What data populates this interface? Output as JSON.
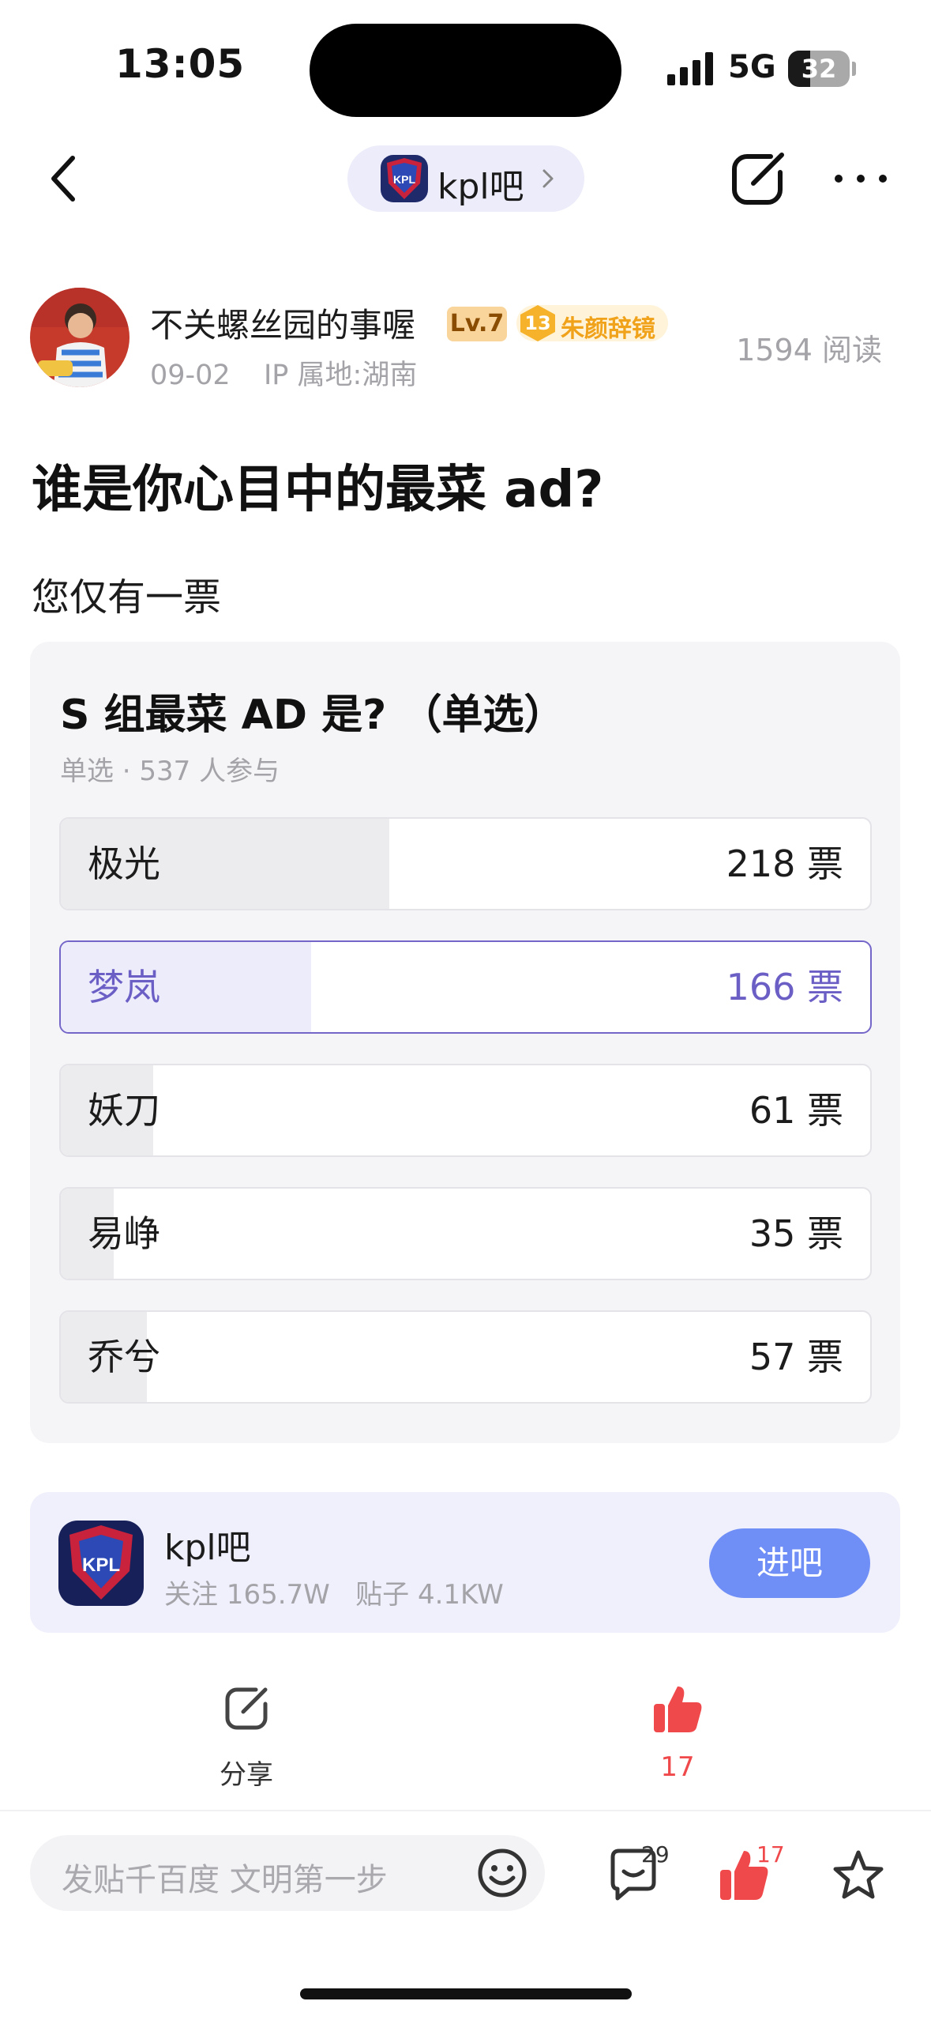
{
  "status_bar": {
    "time": "13:05",
    "network": "5G",
    "battery": "32"
  },
  "nav": {
    "forum_label": "kpl吧"
  },
  "author": {
    "name": "不关螺丝园的事喔",
    "level": "Lv.7",
    "fan_level": "13",
    "fan_label": "朱颜辞镜",
    "date": "09-02",
    "ip_location": "IP 属地:湖南",
    "reads": "1594 阅读"
  },
  "post": {
    "title": "谁是你心目中的最菜 ad?",
    "text": "您仅有一票"
  },
  "poll": {
    "title": "S 组最菜 AD 是? （单选）",
    "meta": "单选 · 537 人参与",
    "options": [
      {
        "name": "极光",
        "votes": "218 票",
        "share": 0.406,
        "selected": false
      },
      {
        "name": "梦岚",
        "votes": "166 票",
        "share": 0.309,
        "selected": true
      },
      {
        "name": "妖刀",
        "votes": "61 票",
        "share": 0.114,
        "selected": false
      },
      {
        "name": "易峥",
        "votes": "35 票",
        "share": 0.065,
        "selected": false
      },
      {
        "name": "乔兮",
        "votes": "57 票",
        "share": 0.106,
        "selected": false
      }
    ]
  },
  "forum_card": {
    "name": "kpl吧",
    "stats": "关注 165.7W   贴子 4.1KW",
    "enter_label": "进吧"
  },
  "actions": {
    "share_label": "分享",
    "like_count": "17"
  },
  "bottom_bar": {
    "placeholder": "发贴千百度 文明第一步",
    "comment_count": "29",
    "like_count": "17"
  },
  "colors": {
    "accent": "#6b5fc6",
    "enter_button": "#6f8ef6",
    "like_red": "#f0494b",
    "gold": "#f0a21a"
  }
}
